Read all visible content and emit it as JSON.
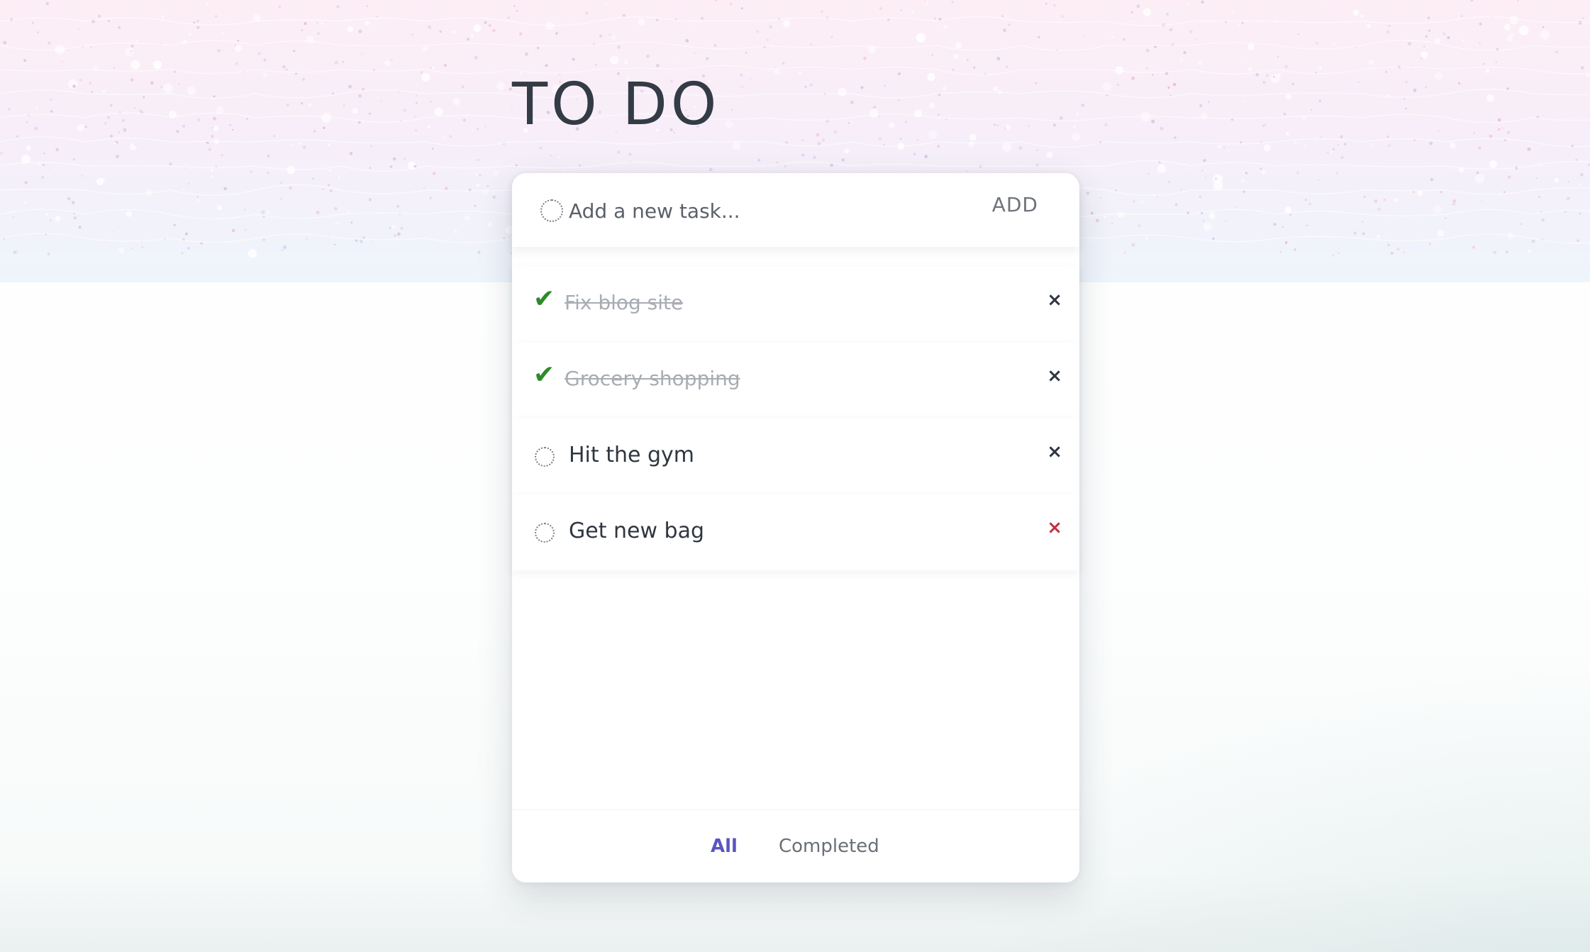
{
  "app": {
    "title": "TO DO"
  },
  "new_task": {
    "placeholder": "Add a new task...",
    "add_label": "ADD"
  },
  "tasks": [
    {
      "text": "Fix blog site",
      "completed": true,
      "delete_glyph": "×"
    },
    {
      "text": "Grocery shopping",
      "completed": true,
      "delete_glyph": "×"
    },
    {
      "text": "Hit the gym",
      "completed": false,
      "delete_glyph": "×"
    },
    {
      "text": "Get new bag",
      "completed": false,
      "delete_glyph": "×"
    }
  ],
  "check_glyph": "✔",
  "filters": {
    "all_label": "All",
    "completed_label": "Completed",
    "active": "All"
  },
  "colors": {
    "accent": "#5b55c2",
    "check": "#2d8a2a",
    "delete_hover": "#c0323c",
    "title": "#333b45"
  }
}
